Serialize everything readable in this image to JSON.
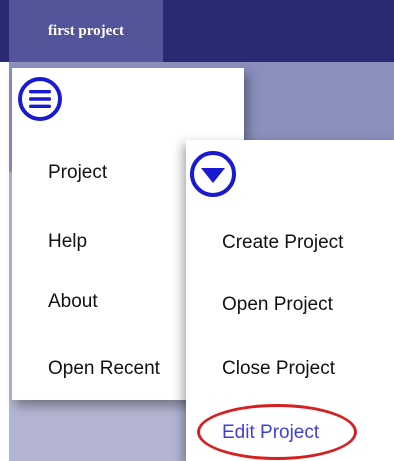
{
  "tab": {
    "title": "first project"
  },
  "main_menu": {
    "items": [
      {
        "label": "Project"
      },
      {
        "label": "Help"
      },
      {
        "label": "About"
      },
      {
        "label": "Open Recent"
      }
    ]
  },
  "project_submenu": {
    "items": [
      {
        "label": "Create Project"
      },
      {
        "label": "Open Project"
      },
      {
        "label": "Close Project"
      },
      {
        "label": "Edit Project"
      }
    ]
  },
  "icons": {
    "menu": "hamburger-menu-icon",
    "pencil": "pencil-icon",
    "dropdown": "chevron-down-icon"
  },
  "colors": {
    "topbar": "#2a2a72",
    "tab": "#54549a",
    "annotation_blue": "#1a1ad0",
    "annotation_red": "#d42020",
    "highlight_text": "#3f42d6"
  }
}
